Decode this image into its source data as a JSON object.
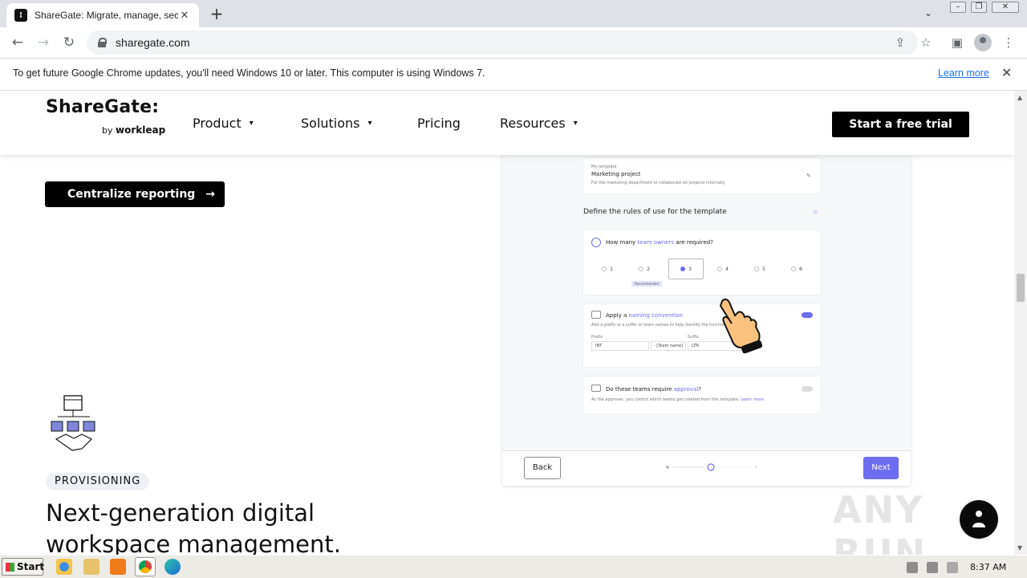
{
  "browser": {
    "tab_title": "ShareGate: Migrate, manage, secure",
    "tab_close": "✕",
    "new_tab": "+",
    "url": "sharegate.com",
    "infobar_message": "To get future Google Chrome updates, you'll need Windows 10 or later. This computer is using Windows 7.",
    "infobar_link": "Learn more",
    "infobar_close": "✕"
  },
  "site": {
    "brand": "ShareGate:",
    "brand_sub_by": "by",
    "brand_sub_name": "workleap",
    "nav": [
      {
        "label": "Product"
      },
      {
        "label": "Solutions"
      },
      {
        "label": "Pricing"
      },
      {
        "label": "Resources"
      }
    ],
    "cta": "Start a free trial"
  },
  "content": {
    "centralize_button": "Centralize reporting",
    "centralize_arrow": "→",
    "provisioning_badge": "PROVISIONING",
    "provisioning_title": "Next-generation digital workspace management."
  },
  "panel": {
    "template_label": "My template",
    "template_name": "Marketing project",
    "template_desc": "For the marketing department to collaborate on projects internally",
    "section_title": "Define the rules of use for the template",
    "q1_prefix": "How many ",
    "q1_link": "team owners",
    "q1_suffix": " are required?",
    "options": [
      "1",
      "2",
      "3",
      "4",
      "5",
      "6"
    ],
    "recommended": "Recommended",
    "q2_prefix": "Apply a ",
    "q2_link": "naming convention",
    "q2_desc": "Add a prefix or a suffix to team names to help identify the function of these teams.",
    "prefix_label": "Prefix",
    "suffix_label": "Suffix",
    "prefix_value": "INT",
    "team_name": "- [Team name] -",
    "suffix_value": "LTN",
    "q3_prefix": "Do these teams require ",
    "q3_link": "approval",
    "q3_suffix": "?",
    "q3_desc": "As the approver, you control which teams get created from this template.",
    "q3_learn": "Learn more",
    "back": "Back",
    "next": "Next"
  },
  "watermark": "ANY RUN",
  "taskbar": {
    "start": "Start",
    "clock": "8:37 AM"
  },
  "colors": {
    "accent": "#6f6cf4",
    "cta_bg": "#000000",
    "badge_bg": "#eef0f6",
    "link": "#1a73e8"
  }
}
